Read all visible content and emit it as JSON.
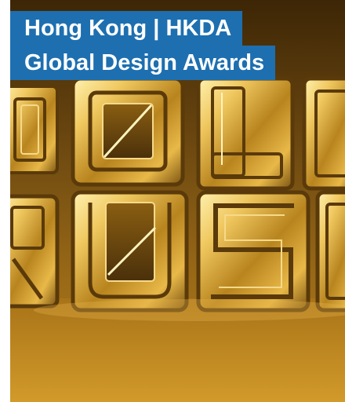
{
  "title": {
    "line1": "Hong Kong | HKDA",
    "line2": "Global Design Awards"
  },
  "image": {
    "subject": "gold-rush-3d-letters",
    "dominant_color": "#b07a1c"
  }
}
